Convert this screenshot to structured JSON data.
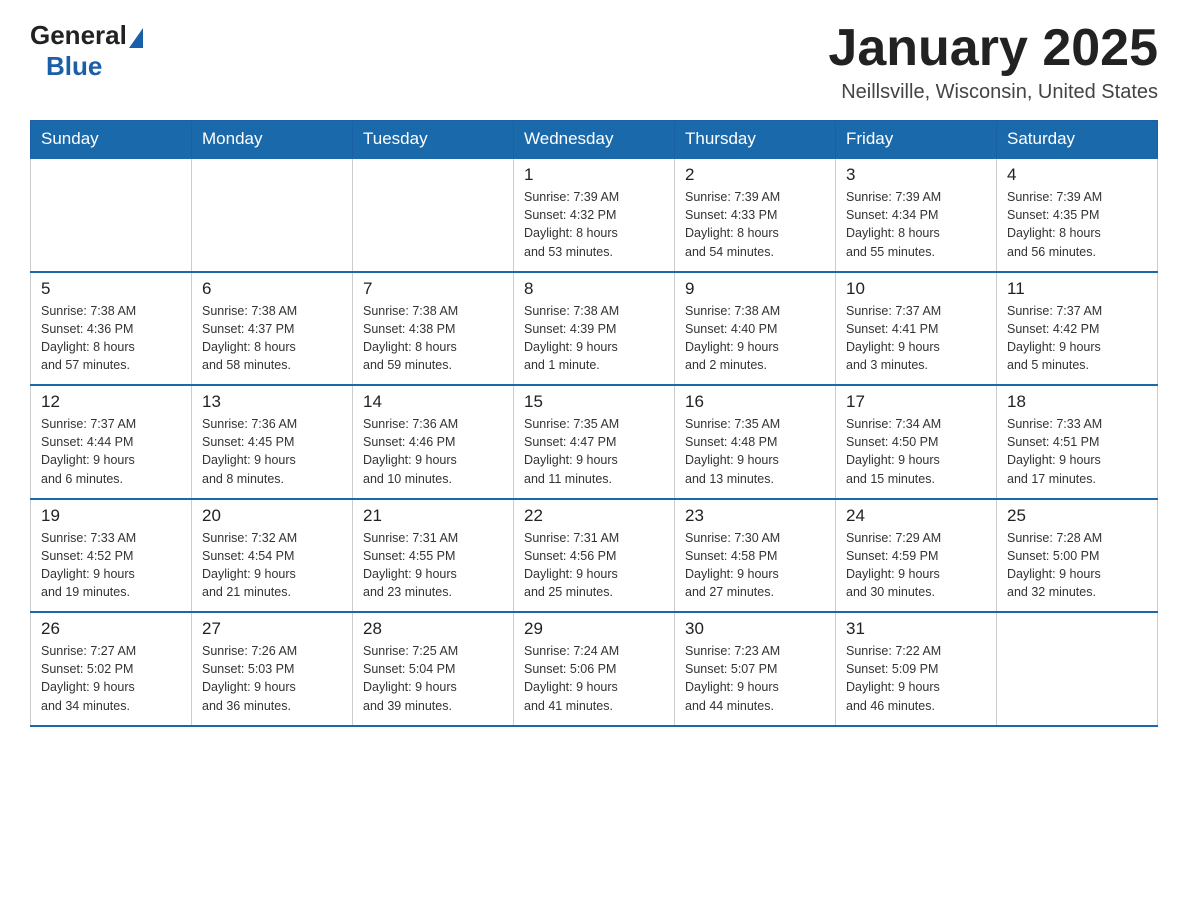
{
  "logo": {
    "general": "General",
    "blue": "Blue"
  },
  "title": "January 2025",
  "location": "Neillsville, Wisconsin, United States",
  "days_header": [
    "Sunday",
    "Monday",
    "Tuesday",
    "Wednesday",
    "Thursday",
    "Friday",
    "Saturday"
  ],
  "weeks": [
    [
      {
        "day": "",
        "info": ""
      },
      {
        "day": "",
        "info": ""
      },
      {
        "day": "",
        "info": ""
      },
      {
        "day": "1",
        "info": "Sunrise: 7:39 AM\nSunset: 4:32 PM\nDaylight: 8 hours\nand 53 minutes."
      },
      {
        "day": "2",
        "info": "Sunrise: 7:39 AM\nSunset: 4:33 PM\nDaylight: 8 hours\nand 54 minutes."
      },
      {
        "day": "3",
        "info": "Sunrise: 7:39 AM\nSunset: 4:34 PM\nDaylight: 8 hours\nand 55 minutes."
      },
      {
        "day": "4",
        "info": "Sunrise: 7:39 AM\nSunset: 4:35 PM\nDaylight: 8 hours\nand 56 minutes."
      }
    ],
    [
      {
        "day": "5",
        "info": "Sunrise: 7:38 AM\nSunset: 4:36 PM\nDaylight: 8 hours\nand 57 minutes."
      },
      {
        "day": "6",
        "info": "Sunrise: 7:38 AM\nSunset: 4:37 PM\nDaylight: 8 hours\nand 58 minutes."
      },
      {
        "day": "7",
        "info": "Sunrise: 7:38 AM\nSunset: 4:38 PM\nDaylight: 8 hours\nand 59 minutes."
      },
      {
        "day": "8",
        "info": "Sunrise: 7:38 AM\nSunset: 4:39 PM\nDaylight: 9 hours\nand 1 minute."
      },
      {
        "day": "9",
        "info": "Sunrise: 7:38 AM\nSunset: 4:40 PM\nDaylight: 9 hours\nand 2 minutes."
      },
      {
        "day": "10",
        "info": "Sunrise: 7:37 AM\nSunset: 4:41 PM\nDaylight: 9 hours\nand 3 minutes."
      },
      {
        "day": "11",
        "info": "Sunrise: 7:37 AM\nSunset: 4:42 PM\nDaylight: 9 hours\nand 5 minutes."
      }
    ],
    [
      {
        "day": "12",
        "info": "Sunrise: 7:37 AM\nSunset: 4:44 PM\nDaylight: 9 hours\nand 6 minutes."
      },
      {
        "day": "13",
        "info": "Sunrise: 7:36 AM\nSunset: 4:45 PM\nDaylight: 9 hours\nand 8 minutes."
      },
      {
        "day": "14",
        "info": "Sunrise: 7:36 AM\nSunset: 4:46 PM\nDaylight: 9 hours\nand 10 minutes."
      },
      {
        "day": "15",
        "info": "Sunrise: 7:35 AM\nSunset: 4:47 PM\nDaylight: 9 hours\nand 11 minutes."
      },
      {
        "day": "16",
        "info": "Sunrise: 7:35 AM\nSunset: 4:48 PM\nDaylight: 9 hours\nand 13 minutes."
      },
      {
        "day": "17",
        "info": "Sunrise: 7:34 AM\nSunset: 4:50 PM\nDaylight: 9 hours\nand 15 minutes."
      },
      {
        "day": "18",
        "info": "Sunrise: 7:33 AM\nSunset: 4:51 PM\nDaylight: 9 hours\nand 17 minutes."
      }
    ],
    [
      {
        "day": "19",
        "info": "Sunrise: 7:33 AM\nSunset: 4:52 PM\nDaylight: 9 hours\nand 19 minutes."
      },
      {
        "day": "20",
        "info": "Sunrise: 7:32 AM\nSunset: 4:54 PM\nDaylight: 9 hours\nand 21 minutes."
      },
      {
        "day": "21",
        "info": "Sunrise: 7:31 AM\nSunset: 4:55 PM\nDaylight: 9 hours\nand 23 minutes."
      },
      {
        "day": "22",
        "info": "Sunrise: 7:31 AM\nSunset: 4:56 PM\nDaylight: 9 hours\nand 25 minutes."
      },
      {
        "day": "23",
        "info": "Sunrise: 7:30 AM\nSunset: 4:58 PM\nDaylight: 9 hours\nand 27 minutes."
      },
      {
        "day": "24",
        "info": "Sunrise: 7:29 AM\nSunset: 4:59 PM\nDaylight: 9 hours\nand 30 minutes."
      },
      {
        "day": "25",
        "info": "Sunrise: 7:28 AM\nSunset: 5:00 PM\nDaylight: 9 hours\nand 32 minutes."
      }
    ],
    [
      {
        "day": "26",
        "info": "Sunrise: 7:27 AM\nSunset: 5:02 PM\nDaylight: 9 hours\nand 34 minutes."
      },
      {
        "day": "27",
        "info": "Sunrise: 7:26 AM\nSunset: 5:03 PM\nDaylight: 9 hours\nand 36 minutes."
      },
      {
        "day": "28",
        "info": "Sunrise: 7:25 AM\nSunset: 5:04 PM\nDaylight: 9 hours\nand 39 minutes."
      },
      {
        "day": "29",
        "info": "Sunrise: 7:24 AM\nSunset: 5:06 PM\nDaylight: 9 hours\nand 41 minutes."
      },
      {
        "day": "30",
        "info": "Sunrise: 7:23 AM\nSunset: 5:07 PM\nDaylight: 9 hours\nand 44 minutes."
      },
      {
        "day": "31",
        "info": "Sunrise: 7:22 AM\nSunset: 5:09 PM\nDaylight: 9 hours\nand 46 minutes."
      },
      {
        "day": "",
        "info": ""
      }
    ]
  ]
}
